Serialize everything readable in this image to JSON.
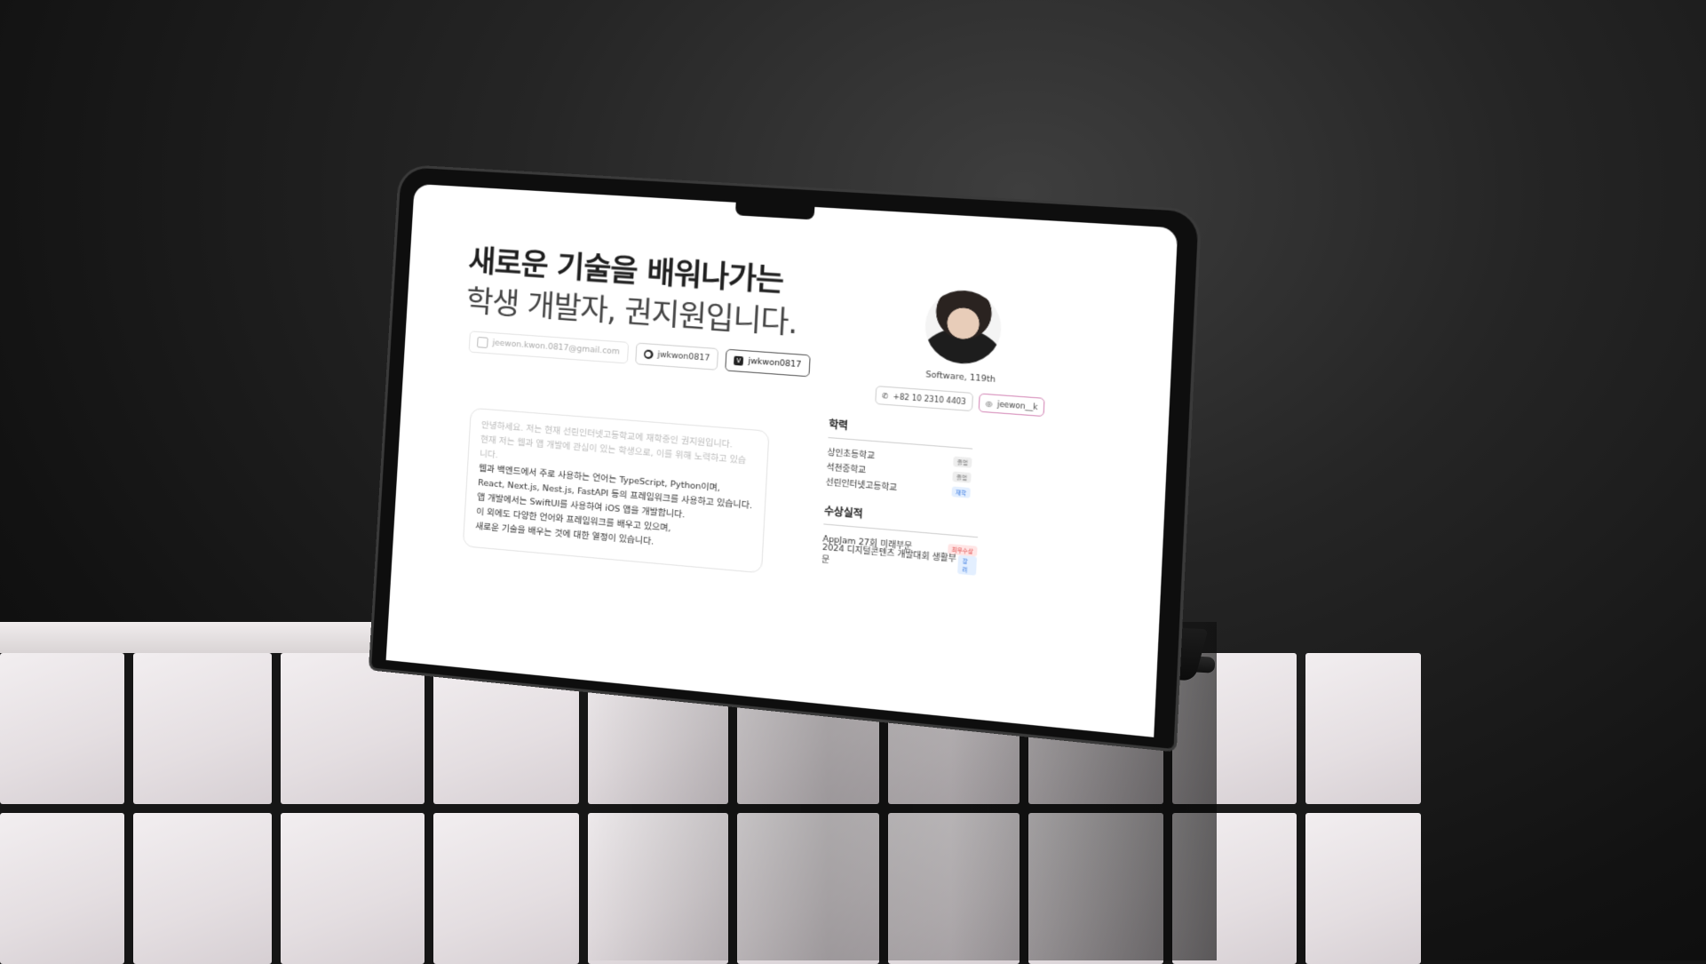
{
  "headline": {
    "line1": "새로운 기술을 배워나가는",
    "line2": "학생 개발자, 권지원입니다."
  },
  "links": {
    "email": "jeewon.kwon.0817@gmail.com",
    "github": "jwkwon0817",
    "velog": "jwkwon0817"
  },
  "intro": {
    "lines": [
      "안녕하세요. 저는 현재 선린인터넷고등학교에 재학중인 권지원입니다.",
      "현재 저는 웹과 앱 개발에 관심이 있는 학생으로, 이를 위해 노력하고 있습",
      "니다.",
      "웹과 백엔드에서 주로 사용하는 언어는 TypeScript, Python이며,",
      "React, Next.js, Nest.js, FastAPI 등의 프레임워크를 사용하고 있습니다.",
      "앱 개발에서는 SwiftUI를 사용하여 iOS 앱을 개발합니다.",
      "이 외에도 다양한 언어와 프레임워크를 배우고 있으며,",
      "새로운 기술을 배우는 것에 대한 열정이 있습니다."
    ]
  },
  "profile": {
    "role": "Software, 119th",
    "phone": "+82 10 2310 4403",
    "instagram": "jeewon__k"
  },
  "education": {
    "title": "학력",
    "items": [
      {
        "name": "상인초등학교",
        "badge": "졸업"
      },
      {
        "name": "석천중학교",
        "badge": "졸업"
      },
      {
        "name": "선린인터넷고등학교",
        "badge": "재학"
      }
    ]
  },
  "awards": {
    "title": "수상실적",
    "items": [
      {
        "name": "AppJam 27회 미래부문",
        "badge": "최우수상"
      },
      {
        "name": "2024 디지털콘텐츠 개발대회 생활부문",
        "badge": "장려"
      }
    ]
  },
  "colors": {
    "screen_bg": "#ffffff",
    "accent_blue": "#3b7be0",
    "accent_red": "#e04545",
    "instagram_border": "#d58ab8"
  }
}
